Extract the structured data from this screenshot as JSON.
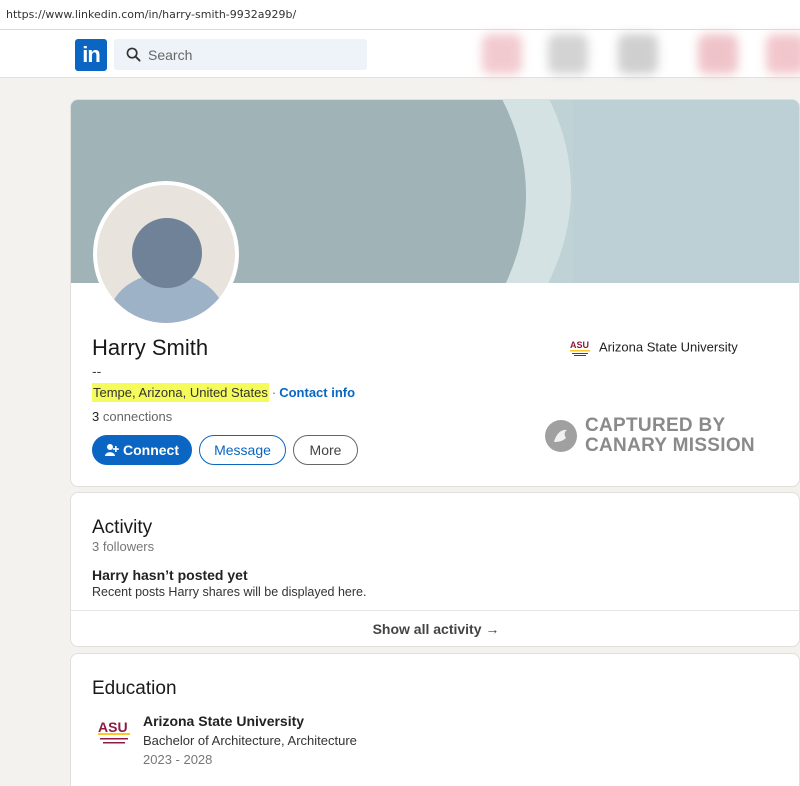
{
  "browser": {
    "url": "https://www.linkedin.com/in/harry-smith-9932a929b/"
  },
  "nav": {
    "logo_text": "in",
    "search_placeholder": "Search"
  },
  "profile": {
    "name": "Harry Smith",
    "headline": "--",
    "location": "Tempe, Arizona, United States",
    "separator": "·",
    "contact_info_label": "Contact info",
    "connections_count": "3",
    "connections_label": " connections",
    "buttons": {
      "connect": "Connect",
      "message": "Message",
      "more": "More"
    },
    "top_education": "Arizona State University"
  },
  "watermark": {
    "line1": "CAPTURED BY",
    "line2": "CANARY MISSION"
  },
  "activity": {
    "title": "Activity",
    "followers": "3 followers",
    "empty_title": "Harry hasn’t posted yet",
    "empty_subtitle": "Recent posts Harry shares will be displayed here.",
    "show_all": "Show all activity →"
  },
  "education": {
    "title": "Education",
    "items": [
      {
        "school": "Arizona State University",
        "degree": "Bachelor of Architecture, Architecture",
        "dates": "2023 - 2028"
      }
    ]
  },
  "colors": {
    "accent": "#0a66c2",
    "highlight": "#f4fb5a",
    "asu_maroon": "#8c1d40",
    "asu_gold": "#ffc627"
  }
}
